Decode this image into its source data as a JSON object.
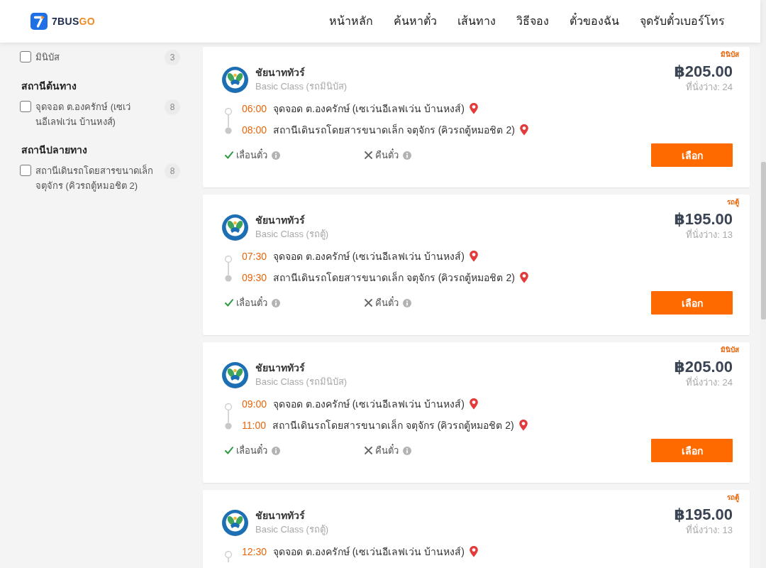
{
  "header": {
    "brand": "7BUS",
    "brand_accent": "GO",
    "nav": [
      "หน้าหลัก",
      "ค้นหาตั๋ว",
      "เส้นทาง",
      "วิธีจอง",
      "ตั๋วของฉัน",
      "จุดรับตั๋วเบอร์โทร"
    ]
  },
  "sidebar": {
    "groups": [
      {
        "items": [
          {
            "label": "มินิบัส",
            "count": "3",
            "checked": false
          }
        ]
      },
      {
        "heading": "สถานีต้นทาง",
        "items": [
          {
            "label": "จุดจอด ต.องครักษ์ (เซเว่นอีเลฟเว่น บ้านหงส์)",
            "count": "8",
            "checked": false
          }
        ]
      },
      {
        "heading": "สถานีปลายทาง",
        "items": [
          {
            "label": "สถานีเดินรถโดยสารขนาดเล็ก จตุจักร (คิวรถตู้หมอชิต 2)",
            "count": "8",
            "checked": false
          }
        ]
      }
    ]
  },
  "results": [
    {
      "tag": "มินิบัส",
      "operator": "ชัยนาททัวร์",
      "class": "Basic Class (รถมินิบัส)",
      "price": "฿205.00",
      "seats": "ที่นั่งว่าง: 24",
      "stops": [
        {
          "kind": "origin",
          "time": "06:00",
          "place": "จุดจอด ต.องครักษ์ (เซเว่นอีเลฟเว่น บ้านหงส์)"
        },
        {
          "kind": "destination",
          "time": "08:00",
          "place": "สถานีเดินรถโดยสารขนาดเล็ก จตุจักร (คิวรถตู้หมอชิต 2)"
        }
      ],
      "policies": [
        {
          "label": "เลื่อนตั๋ว",
          "allowed": true
        },
        {
          "label": "คืนตั๋ว",
          "allowed": false
        }
      ],
      "button": "เลือก"
    },
    {
      "tag": "รถตู้",
      "operator": "ชัยนาททัวร์",
      "class": "Basic Class (รถตู้)",
      "price": "฿195.00",
      "seats": "ที่นั่งว่าง: 13",
      "stops": [
        {
          "kind": "origin",
          "time": "07:30",
          "place": "จุดจอด ต.องครักษ์ (เซเว่นอีเลฟเว่น บ้านหงส์)"
        },
        {
          "kind": "destination",
          "time": "09:30",
          "place": "สถานีเดินรถโดยสารขนาดเล็ก จตุจักร (คิวรถตู้หมอชิต 2)"
        }
      ],
      "policies": [
        {
          "label": "เลื่อนตั๋ว",
          "allowed": true
        },
        {
          "label": "คืนตั๋ว",
          "allowed": false
        }
      ],
      "button": "เลือก"
    },
    {
      "tag": "มินิบัส",
      "operator": "ชัยนาททัวร์",
      "class": "Basic Class (รถมินิบัส)",
      "price": "฿205.00",
      "seats": "ที่นั่งว่าง: 24",
      "stops": [
        {
          "kind": "origin",
          "time": "09:00",
          "place": "จุดจอด ต.องครักษ์ (เซเว่นอีเลฟเว่น บ้านหงส์)"
        },
        {
          "kind": "destination",
          "time": "11:00",
          "place": "สถานีเดินรถโดยสารขนาดเล็ก จตุจักร (คิวรถตู้หมอชิต 2)"
        }
      ],
      "policies": [
        {
          "label": "เลื่อนตั๋ว",
          "allowed": true
        },
        {
          "label": "คืนตั๋ว",
          "allowed": false
        }
      ],
      "button": "เลือก"
    },
    {
      "tag": "รถตู้",
      "operator": "ชัยนาททัวร์",
      "class": "Basic Class (รถตู้)",
      "price": "฿195.00",
      "seats": "ที่นั่งว่าง: 13",
      "stops": [
        {
          "kind": "origin",
          "time": "12:30",
          "place": "จุดจอด ต.องครักษ์ (เซเว่นอีเลฟเว่น บ้านหงส์)"
        }
      ]
    }
  ]
}
